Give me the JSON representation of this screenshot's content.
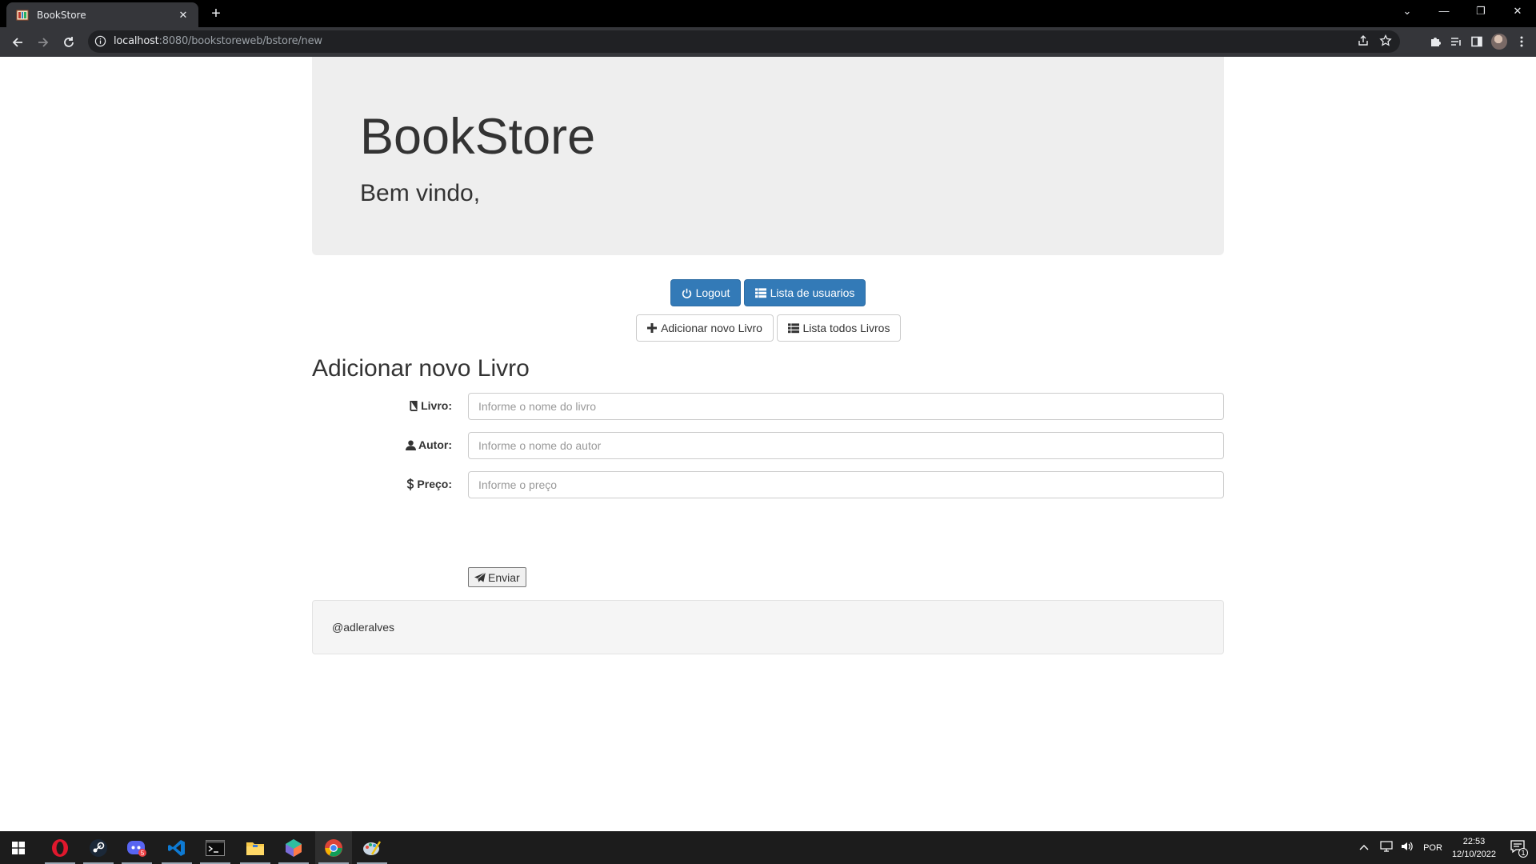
{
  "browser": {
    "tab_title": "BookStore",
    "tab_close": "✕",
    "new_tab": "+",
    "url_host": "localhost",
    "url_rest": ":8080/bookstoreweb/bstore/new"
  },
  "header": {
    "title": "BookStore",
    "subtitle": "Bem vindo,"
  },
  "nav": {
    "logout": "Logout",
    "list_users": "Lista de usuarios",
    "add_book": "Adicionar novo Livro",
    "list_books": "Lista todos Livros"
  },
  "form": {
    "heading": "Adicionar novo Livro",
    "fields": [
      {
        "label": "Livro:",
        "placeholder": "Informe o nome do livro",
        "icon": "book-icon"
      },
      {
        "label": "Autor:",
        "placeholder": "Informe o nome do autor",
        "icon": "user-icon"
      },
      {
        "label": "Preço:",
        "placeholder": "Informe o preço",
        "icon": "dollar-icon"
      }
    ],
    "submit": "Enviar"
  },
  "footer": {
    "text": "@adleralves"
  },
  "taskbar": {
    "apps": [
      "windows-start-icon",
      "opera-icon",
      "steam-icon",
      "discord-icon",
      "vscode-icon",
      "terminal-icon",
      "file-explorer-icon",
      "toolbox-icon",
      "chrome-icon",
      "paint-icon"
    ],
    "discord_badge": "5",
    "lang": "POR",
    "time": "22:53",
    "date": "12/10/2022",
    "notif_count": "1"
  },
  "colors": {
    "primary": "#337ab7",
    "jumbotron": "#eeeeee",
    "chrome_dark": "#35363a"
  }
}
